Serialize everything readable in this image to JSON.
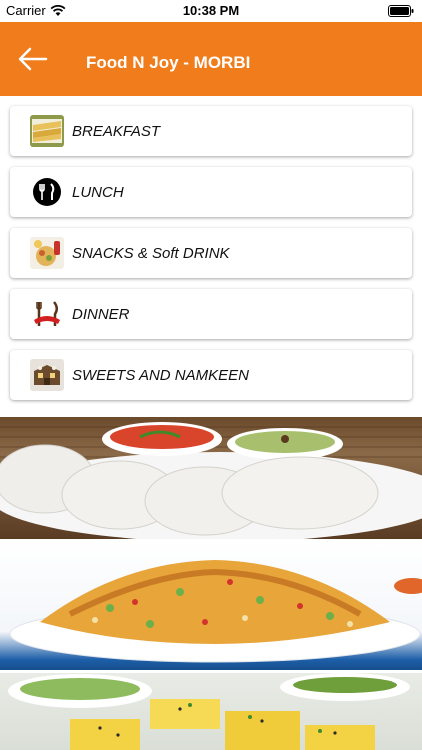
{
  "status_bar": {
    "carrier": "Carrier",
    "time": "10:38 PM",
    "icons": [
      "wifi-icon",
      "battery-icon"
    ]
  },
  "header": {
    "title": "Food N Joy - MORBI",
    "back_icon": "arrow-left-icon",
    "background_color": "#f07c1c"
  },
  "menu": {
    "items": [
      {
        "label": "BREAKFAST",
        "icon": "breakfast-icon"
      },
      {
        "label": "LUNCH",
        "icon": "fork-knife-icon"
      },
      {
        "label": "SNACKS & Soft DRINK",
        "icon": "snacks-icon"
      },
      {
        "label": "DINNER",
        "icon": "dinner-icon"
      },
      {
        "label": "SWEETS AND NAMKEEN",
        "icon": "sweets-icon"
      }
    ]
  },
  "banners": [
    {
      "name": "idli-chutney-photo"
    },
    {
      "name": "namkeen-mix-photo"
    },
    {
      "name": "dhokla-photo"
    }
  ]
}
